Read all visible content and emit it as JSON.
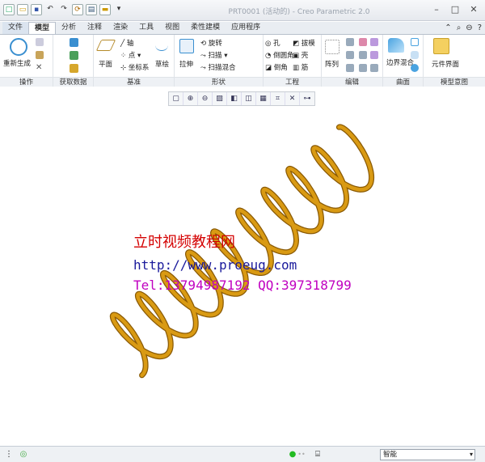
{
  "window": {
    "title": "PRT0001 (活动的) - Creo Parametric 2.0"
  },
  "quick_access": [
    "new-icon",
    "open-icon",
    "save-icon",
    "undo-icon",
    "redo-icon",
    "regenerate-icon",
    "windows-icon",
    "close-icon",
    "customize-icon"
  ],
  "tabs": [
    "文件",
    "模型",
    "分析",
    "注释",
    "渲染",
    "工具",
    "视图",
    "柔性建模",
    "应用程序"
  ],
  "active_tab": "模型",
  "ribbon": {
    "groups": [
      {
        "label": "操作",
        "items": [
          "重新生成"
        ]
      },
      {
        "label": "获取数据",
        "items": []
      },
      {
        "label": "基准",
        "items": [
          "平面",
          "轴",
          "点",
          "坐标系",
          "草绘"
        ]
      },
      {
        "label": "形状",
        "items": [
          "拉伸",
          "旋转",
          "扫描",
          "扫描混合"
        ]
      },
      {
        "label": "工程",
        "items": [
          "孔",
          "拔模",
          "倒圆角",
          "壳",
          "倒角",
          "筋"
        ]
      },
      {
        "label": "编辑",
        "items": [
          "阵列"
        ]
      },
      {
        "label": "曲面",
        "items": [
          "边界混合"
        ]
      },
      {
        "label": "模型意图",
        "items": [
          "元件界面"
        ]
      }
    ]
  },
  "view_toolbar": [
    "zoom-fit-icon",
    "zoom-in-icon",
    "zoom-out-icon",
    "repaint-icon",
    "display-style-icon",
    "saved-views-icon",
    "view-manager-icon",
    "datum-display-icon",
    "annotation-display-icon",
    "spin-center-icon"
  ],
  "watermark": {
    "line1": "立时视频教程网",
    "line2": "http://www.proeug.com",
    "line3": "Tel:13794987192  QQ:397318799"
  },
  "status": {
    "filter_value": "智能"
  },
  "colors": {
    "spring": "#d99a13",
    "spring_dark": "#8a5a05",
    "ribbon_bg": "#ffffff"
  }
}
